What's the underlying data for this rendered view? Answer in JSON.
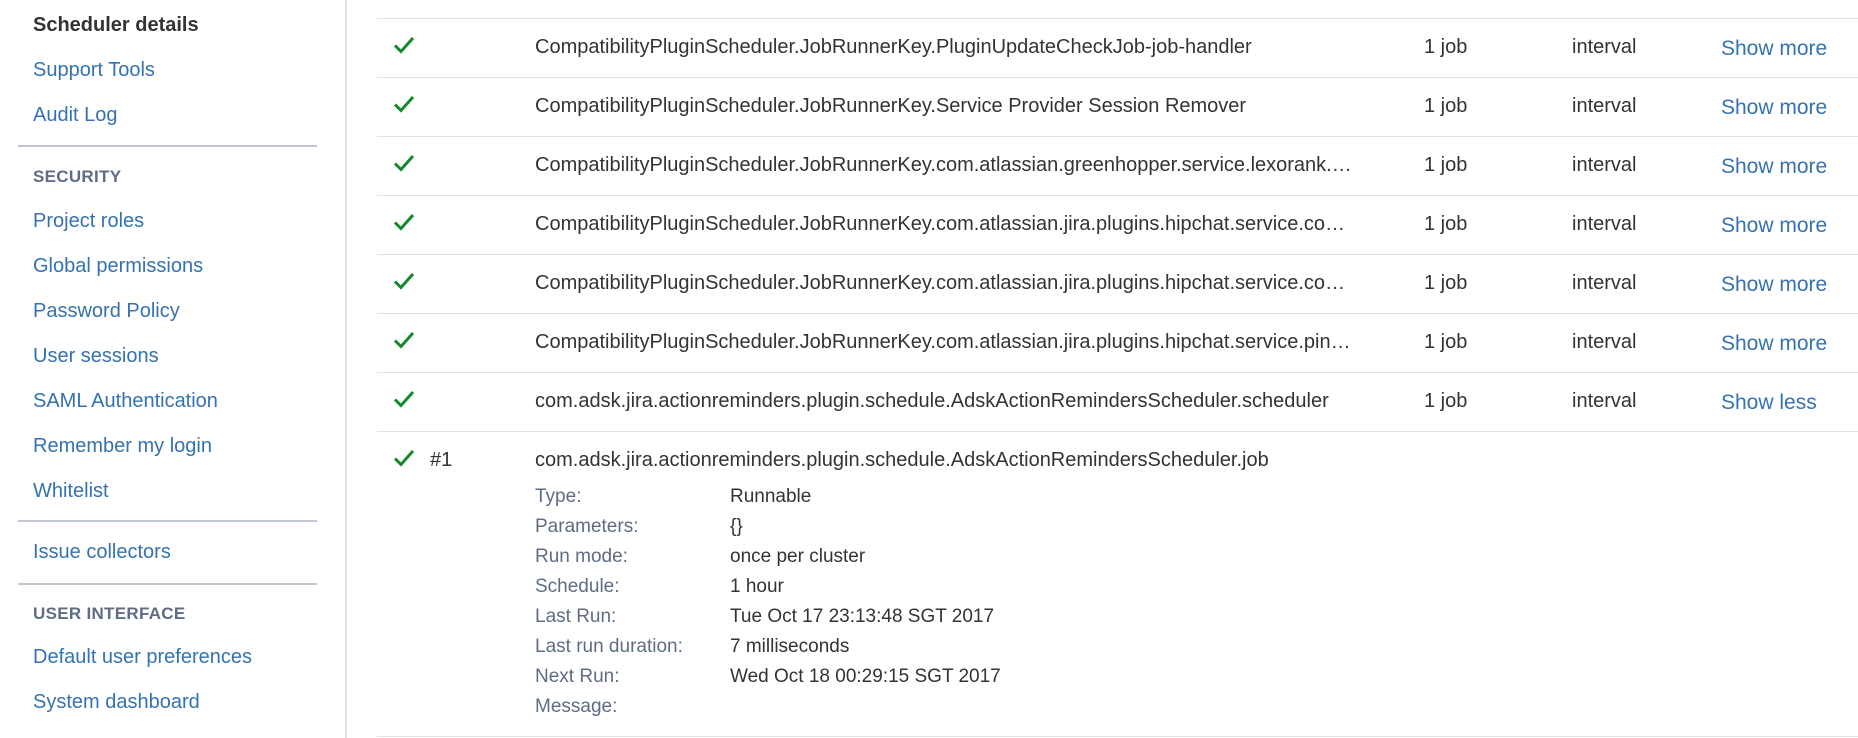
{
  "sidebar": {
    "items_top": [
      {
        "label": "Scheduler details",
        "current": true
      },
      {
        "label": "Support Tools"
      },
      {
        "label": "Audit Log"
      }
    ],
    "security_heading": "SECURITY",
    "security_items": [
      {
        "label": "Project roles"
      },
      {
        "label": "Global permissions"
      },
      {
        "label": "Password Policy"
      },
      {
        "label": "User sessions"
      },
      {
        "label": "SAML Authentication"
      },
      {
        "label": "Remember my login"
      },
      {
        "label": "Whitelist"
      }
    ],
    "other_items": [
      {
        "label": "Issue collectors"
      }
    ],
    "ui_heading": "USER INTERFACE",
    "ui_items": [
      {
        "label": "Default user preferences"
      },
      {
        "label": "System dashboard"
      }
    ]
  },
  "jobs": [
    {
      "status_icon": "check-icon",
      "key": "CompatibilityPluginScheduler.JobRunnerKey.PluginUpdateCheckJob-job-handler",
      "count": "1 job",
      "schedule_type": "interval",
      "toggle": "Show more"
    },
    {
      "status_icon": "check-icon",
      "key": "CompatibilityPluginScheduler.JobRunnerKey.Service Provider Session Remover",
      "count": "1 job",
      "schedule_type": "interval",
      "toggle": "Show more"
    },
    {
      "status_icon": "check-icon",
      "key": "CompatibilityPluginScheduler.JobRunnerKey.com.atlassian.greenhopper.service.lexorank.…",
      "count": "1 job",
      "schedule_type": "interval",
      "toggle": "Show more"
    },
    {
      "status_icon": "check-icon",
      "key": "CompatibilityPluginScheduler.JobRunnerKey.com.atlassian.jira.plugins.hipchat.service.co…",
      "count": "1 job",
      "schedule_type": "interval",
      "toggle": "Show more"
    },
    {
      "status_icon": "check-icon",
      "key": "CompatibilityPluginScheduler.JobRunnerKey.com.atlassian.jira.plugins.hipchat.service.co…",
      "count": "1 job",
      "schedule_type": "interval",
      "toggle": "Show more"
    },
    {
      "status_icon": "check-icon",
      "key": "CompatibilityPluginScheduler.JobRunnerKey.com.atlassian.jira.plugins.hipchat.service.pin…",
      "count": "1 job",
      "schedule_type": "interval",
      "toggle": "Show more"
    },
    {
      "status_icon": "check-icon",
      "key": "com.adsk.jira.actionreminders.plugin.schedule.AdskActionRemindersScheduler.scheduler",
      "count": "1 job",
      "schedule_type": "interval",
      "toggle": "Show less"
    }
  ],
  "expanded_job": {
    "status_icon": "check-icon",
    "id": "#1",
    "name": "com.adsk.jira.actionreminders.plugin.schedule.AdskActionRemindersScheduler.job",
    "details": [
      {
        "label": "Type:",
        "value": "Runnable"
      },
      {
        "label": "Parameters:",
        "value": "{}"
      },
      {
        "label": "Run mode:",
        "value": "once per cluster"
      },
      {
        "label": "Schedule:",
        "value": "1 hour"
      },
      {
        "label": "Last Run:",
        "value": "Tue Oct 17 23:13:48 SGT 2017"
      },
      {
        "label": "Last run duration:",
        "value": "7 milliseconds"
      },
      {
        "label": "Next Run:",
        "value": "Wed Oct 18 00:29:15 SGT 2017"
      },
      {
        "label": "Message:",
        "value": ""
      }
    ]
  },
  "colors": {
    "link": "#3572b0",
    "success": "#14892c",
    "text": "#333333"
  }
}
